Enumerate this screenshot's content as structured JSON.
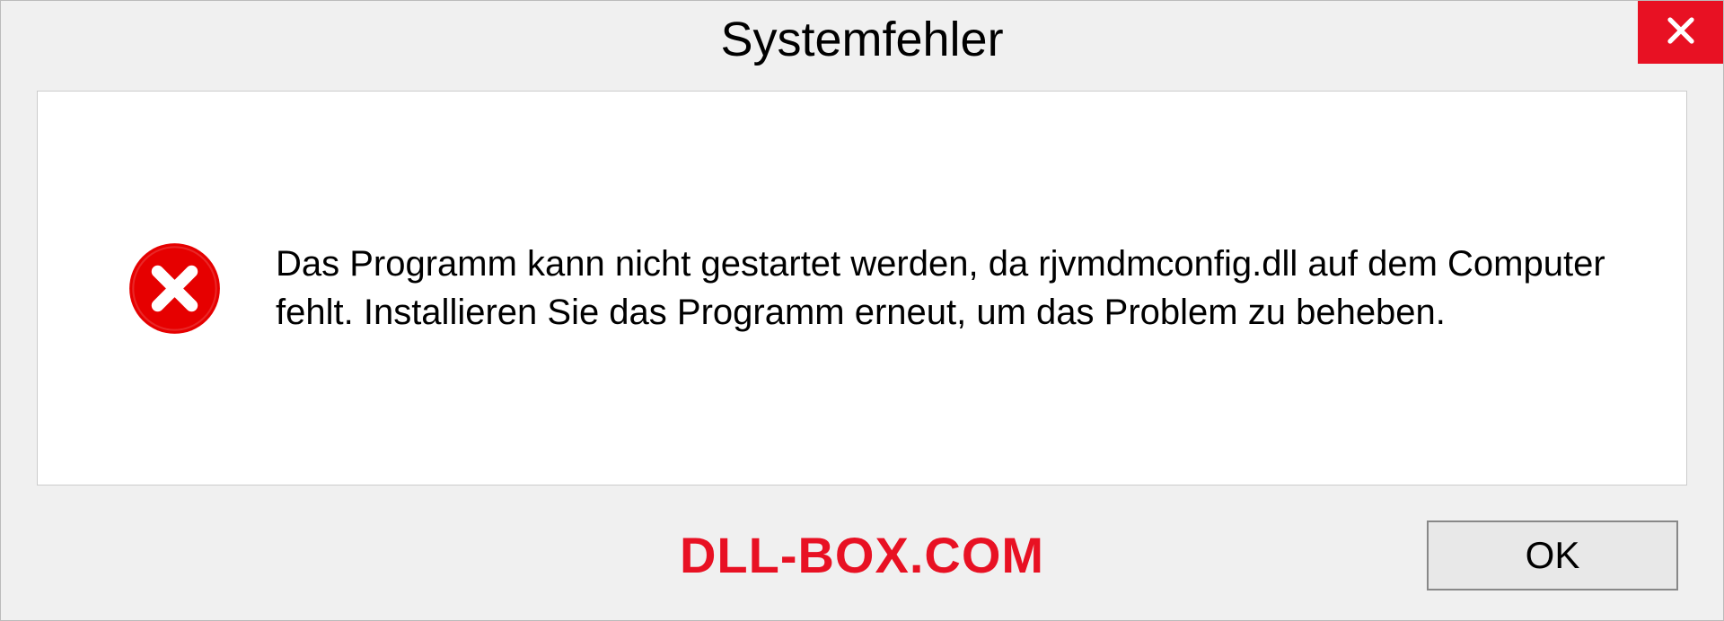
{
  "dialog": {
    "title": "Systemfehler",
    "message": "Das Programm kann nicht gestartet werden, da rjvmdmconfig.dll auf dem Computer fehlt. Installieren Sie das Programm erneut, um das Problem zu beheben.",
    "ok_label": "OK"
  },
  "watermark": "DLL-BOX.COM"
}
